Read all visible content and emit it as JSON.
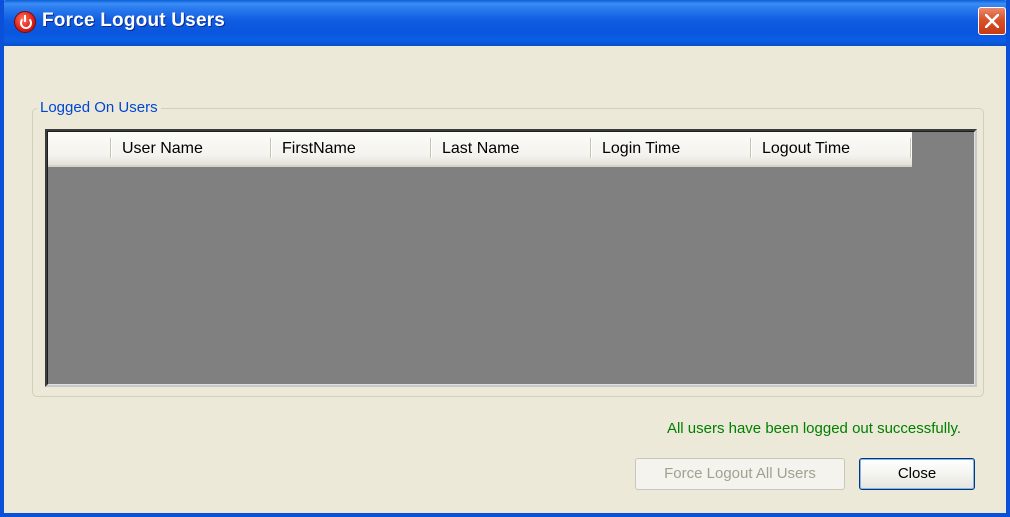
{
  "window": {
    "title": "Force Logout Users",
    "close_icon": "close-icon"
  },
  "group": {
    "legend": "Logged On Users"
  },
  "grid": {
    "columns": [
      "User Name",
      "FirstName",
      "Last Name",
      "Login Time",
      "Logout Time"
    ],
    "rows": []
  },
  "status": {
    "message": "All users have been logged out successfully."
  },
  "buttons": {
    "force_logout_label": "Force Logout All Users",
    "close_label": "Close"
  },
  "colors": {
    "title_bar": "#0a56dd",
    "status_text": "#008000",
    "legend_text": "#0046d5",
    "grid_background": "#808080"
  }
}
